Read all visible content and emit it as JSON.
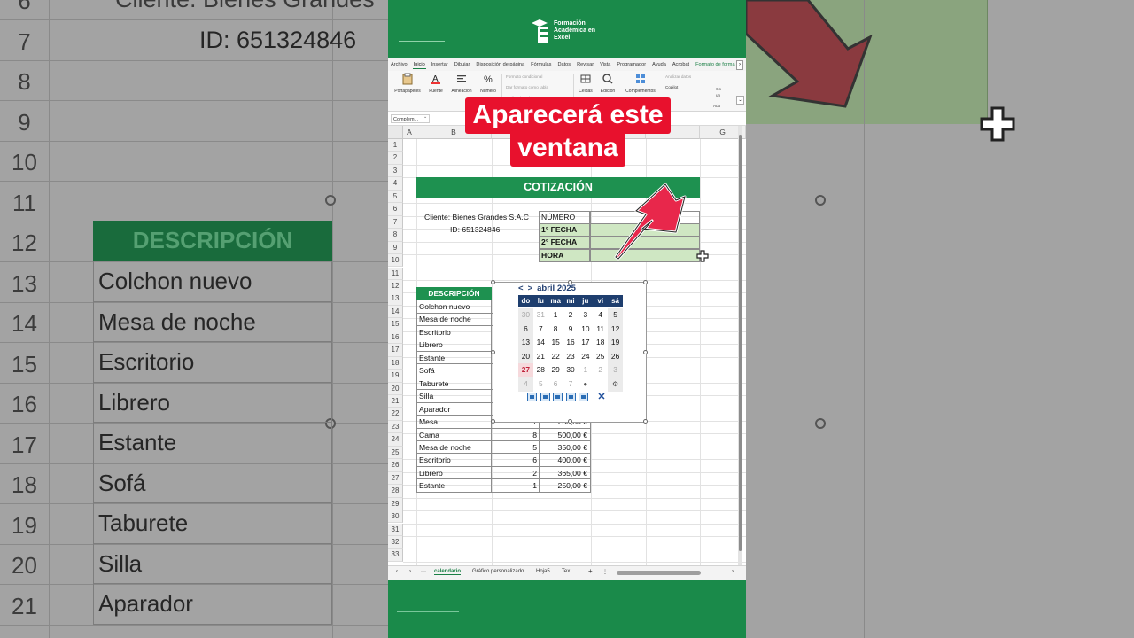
{
  "background": {
    "row_numbers": [
      "6",
      "7",
      "8",
      "9",
      "10",
      "11",
      "12",
      "13",
      "14",
      "15",
      "16",
      "17",
      "18",
      "19",
      "20",
      "21"
    ],
    "cliente_text": "Cliente: Bienes Grandes",
    "id_text": "ID: 651324846",
    "desc_header": "DESCRIPCIÓN",
    "items": [
      "Colchon nuevo",
      "Mesa de noche",
      "Escritorio",
      "Librero",
      "Estante",
      "Sofá",
      "Taburete",
      "Silla",
      "Aparador"
    ]
  },
  "brand": {
    "line1": "Formación",
    "line2": "Académica en",
    "line3": "Excel"
  },
  "ribbon": {
    "tabs": [
      "Archivo",
      "Inicio",
      "Insertar",
      "Dibujar",
      "Disposición de página",
      "Fórmulas",
      "Datos",
      "Revisar",
      "Vista",
      "Programador",
      "Ayuda",
      "Acrobat",
      "Formato de forma"
    ],
    "active_tab": "Inicio",
    "buttons": {
      "paste": "Portapapeles",
      "font": "Fuente",
      "align": "Alineación",
      "number": "Número",
      "cells": "Celdas",
      "edit": "Edición",
      "addins": "Complementos",
      "analyze": "Analizar datos",
      "copilot": "Copilot"
    },
    "cond_format": "Formato condicional",
    "table_format": "Dar formato como tabla",
    "cell_styles": "Estilos de celda",
    "side_label_1": "Co",
    "side_label_2": "un",
    "side_label_3": "Ado"
  },
  "formula_bar": {
    "name_box": "Complem..."
  },
  "sheet": {
    "columns": [
      "A",
      "B",
      "C",
      "D",
      "E",
      "F",
      "G"
    ],
    "title": "COTIZACIÓN",
    "client": "Cliente: Bienes Grandes S.A.C",
    "id": "ID: 651324846",
    "labels": {
      "numero": "NÚMERO",
      "fecha1": "1° FECHA",
      "fecha2": "2° FECHA",
      "hora": "HORA"
    },
    "desc_header": "DESCRIPCIÓN",
    "items": [
      {
        "desc": "Colchon nuevo"
      },
      {
        "desc": "Mesa de noche"
      },
      {
        "desc": "Escritorio"
      },
      {
        "desc": "Librero"
      },
      {
        "desc": "Estante"
      },
      {
        "desc": "Sofá"
      },
      {
        "desc": "Taburete"
      },
      {
        "desc": "Silla"
      },
      {
        "desc": "Aparador"
      },
      {
        "desc": "Mesa",
        "qty": "7",
        "price": "250,00 €"
      },
      {
        "desc": "Cama",
        "qty": "8",
        "price": "500,00 €"
      },
      {
        "desc": "Mesa de noche",
        "qty": "5",
        "price": "350,00 €"
      },
      {
        "desc": "Escritorio",
        "qty": "6",
        "price": "400,00 €"
      },
      {
        "desc": "Librero",
        "qty": "2",
        "price": "365,00 €"
      },
      {
        "desc": "Estante",
        "qty": "1",
        "price": "250,00 €"
      }
    ]
  },
  "calendar": {
    "prev": "<",
    "next": ">",
    "month": "abril 2025",
    "weekdays": [
      "do",
      "lu",
      "ma",
      "mi",
      "ju",
      "vi",
      "sá"
    ],
    "weeks": [
      [
        "30",
        "31",
        "1",
        "2",
        "3",
        "4",
        "5"
      ],
      [
        "6",
        "7",
        "8",
        "9",
        "10",
        "11",
        "12"
      ],
      [
        "13",
        "14",
        "15",
        "16",
        "17",
        "18",
        "19"
      ],
      [
        "20",
        "21",
        "22",
        "23",
        "24",
        "25",
        "26"
      ],
      [
        "27",
        "28",
        "29",
        "30",
        "1",
        "2",
        "3"
      ],
      [
        "4",
        "5",
        "6",
        "7",
        "",
        "",
        ""
      ]
    ],
    "today": "27",
    "close": "✕"
  },
  "overlay": {
    "line1": "Aparecerá este",
    "line2": "ventana"
  },
  "sheet_tabs": {
    "tabs": [
      "calendario",
      "Gráfico personalizado",
      "Hoja5",
      "Tex"
    ],
    "active": "calendario",
    "add": "+",
    "more": "⋯"
  },
  "colors": {
    "excel_green": "#1e9150",
    "header_navy": "#1e3e6e",
    "overlay_red": "#e8112d",
    "arrow_red": "#e8274b"
  }
}
